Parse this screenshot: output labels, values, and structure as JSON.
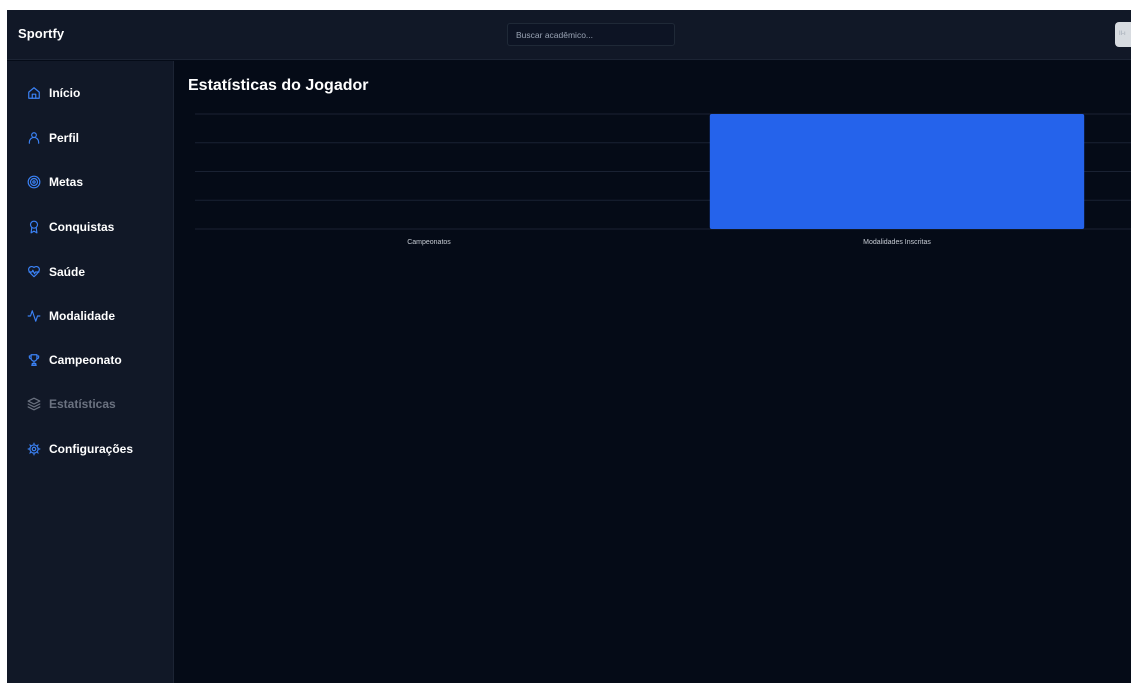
{
  "app": {
    "brand": "Sportfy"
  },
  "search": {
    "placeholder": "Buscar acadêmico..."
  },
  "header": {
    "corner_button_text": "Il-ı"
  },
  "sidebar": {
    "items": [
      {
        "label": "Início",
        "icon": "home-icon",
        "active": false
      },
      {
        "label": "Perfil",
        "icon": "user-icon",
        "active": false
      },
      {
        "label": "Metas",
        "icon": "target-icon",
        "active": false
      },
      {
        "label": "Conquistas",
        "icon": "award-icon",
        "active": false
      },
      {
        "label": "Saúde",
        "icon": "heart-pulse-icon",
        "active": false
      },
      {
        "label": "Modalidade",
        "icon": "activity-icon",
        "active": false
      },
      {
        "label": "Campeonato",
        "icon": "trophy-icon",
        "active": false
      },
      {
        "label": "Estatísticas",
        "icon": "layers-icon",
        "active": true
      },
      {
        "label": "Configurações",
        "icon": "settings-icon",
        "active": false
      }
    ],
    "accent_color": "#3b82f6",
    "inactive_label_color": "#ffffff",
    "active_label_color": "#6b7280"
  },
  "main": {
    "title": "Estatísticas do Jogador"
  },
  "chart_data": {
    "type": "bar",
    "categories": [
      "Campeonatos",
      "Modalidades Inscritas"
    ],
    "values": [
      0,
      1
    ],
    "ylim": [
      0,
      1
    ],
    "grid": true,
    "gridlines": 4,
    "bar_color": "#2563eb",
    "grid_color": "#1a2233",
    "title": "",
    "xlabel": "",
    "ylabel": ""
  }
}
